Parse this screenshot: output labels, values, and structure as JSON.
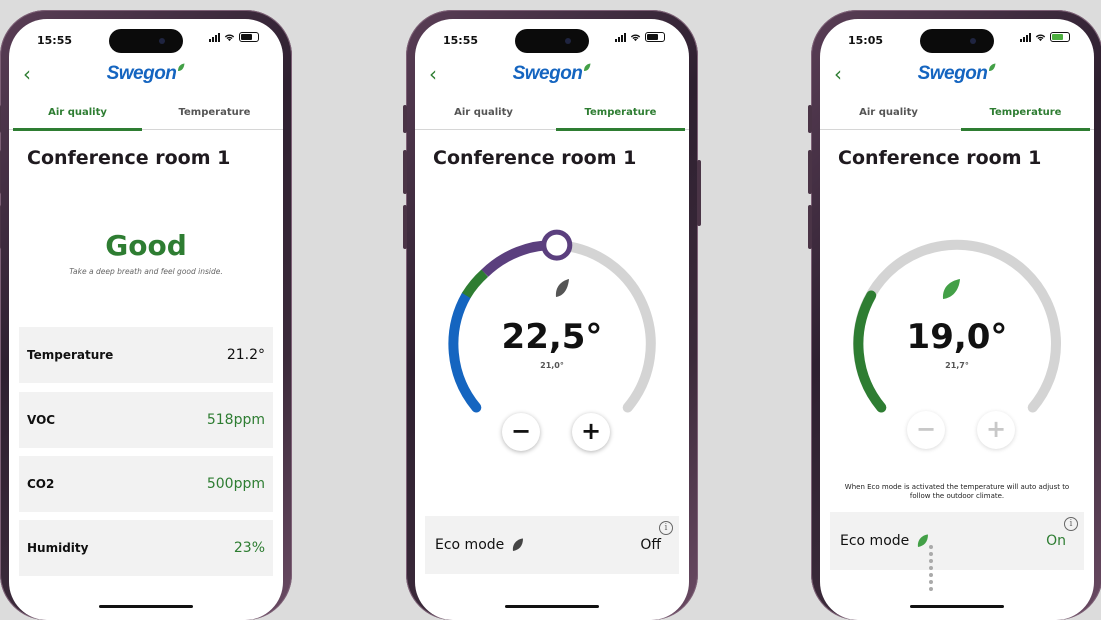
{
  "app": {
    "brand": "Swegon",
    "colors": {
      "accent": "#2e7d32",
      "brand_blue": "#1565c0",
      "cool": "#1565c0",
      "purple": "#5b3f7e",
      "track": "#d4d4d4"
    }
  },
  "phones": [
    {
      "status_time": "15:55",
      "tabs": [
        "Air quality",
        "Temperature"
      ],
      "active_tab": 0,
      "room_title": "Conference room 1",
      "status_word": "Good",
      "tagline": "Take a deep breath and feel good inside.",
      "metrics": [
        {
          "label": "Temperature",
          "value": "21.2°"
        },
        {
          "label": "VOC",
          "value": "518ppm"
        },
        {
          "label": "CO2",
          "value": "500ppm"
        },
        {
          "label": "Humidity",
          "value": "23%"
        }
      ]
    },
    {
      "status_time": "15:55",
      "tabs": [
        "Air quality",
        "Temperature"
      ],
      "active_tab": 1,
      "room_title": "Conference room 1",
      "setpoint": "22,5°",
      "actual": "21,0°",
      "minus": "−",
      "plus": "+",
      "eco_label": "Eco mode",
      "eco_value": "Off",
      "info": "i"
    },
    {
      "status_time": "15:05",
      "tabs": [
        "Air quality",
        "Temperature"
      ],
      "active_tab": 1,
      "room_title": "Conference room 1",
      "setpoint": "19,0°",
      "actual": "21,7°",
      "minus": "−",
      "plus": "+",
      "eco_note": "When Eco mode is activated the temperature will auto adjust to follow the outdoor climate.",
      "eco_label": "Eco mode",
      "eco_value": "On",
      "info": "i"
    }
  ]
}
